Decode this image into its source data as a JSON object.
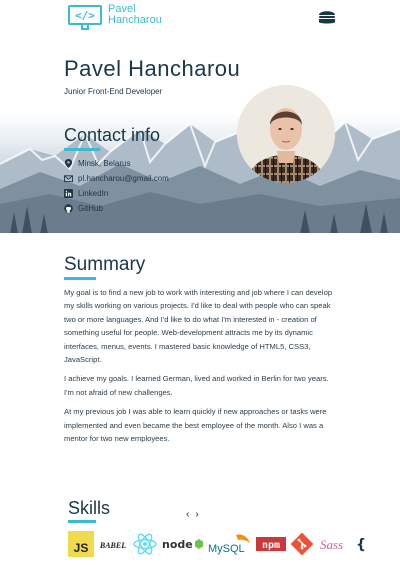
{
  "header": {
    "logo_text_line1": "Pavel",
    "logo_text_line2": "Hancharou",
    "logo_symbol": "</>",
    "menu_icon": "hamburger-icon"
  },
  "profile": {
    "name": "Pavel Hancharou",
    "role": "Junior Front-End Developer"
  },
  "contact": {
    "title": "Contact info",
    "items": [
      {
        "icon": "map-marker-icon",
        "text": "Minsk, Belarus"
      },
      {
        "icon": "envelope-icon",
        "text": "pl.hancharou@gmail.com"
      },
      {
        "icon": "linkedin-icon",
        "text": "LinkedIn"
      },
      {
        "icon": "github-icon",
        "text": "GitHub"
      }
    ]
  },
  "summary": {
    "title": "Summary",
    "paragraphs": [
      "My goal is to find a new job to work with interesting and job where I can develop my skills working on various projects. I'd like to deal with people who can speak two or more languages. And I'd like to do what I'm interested in - creation of something useful for people. Web-development attracts me by its dynamic interfaces, menus, events. I mastered basic knowledge of HTML5, CSS3, JavaScript.",
      "I achieve my goals. I learned German, lived and worked in Berlin for two years. I'm not afraid of new challenges.",
      "At my previous job I was able to learn quickly if new approaches or tasks were implemented and even became the best employee of the month. Also I was a mentor for two new employees."
    ]
  },
  "skills": {
    "title": "Skills",
    "prev": "‹",
    "next": "›",
    "logos": [
      {
        "name": "js-logo",
        "label": "JS"
      },
      {
        "name": "babel-logo",
        "label": "BABEL"
      },
      {
        "name": "react-logo",
        "label": ""
      },
      {
        "name": "nodejs-logo",
        "label": "node"
      },
      {
        "name": "mysql-logo",
        "label": "MySQL"
      },
      {
        "name": "npm-logo",
        "label": "npm"
      },
      {
        "name": "git-logo",
        "label": ""
      },
      {
        "name": "sass-logo",
        "label": "Sass"
      }
    ]
  },
  "colors": {
    "accent": "#3bbbd0",
    "heading": "#17394a",
    "js": "#f0db4f",
    "react": "#61dafb",
    "npm": "#cb3837",
    "git": "#f05033",
    "sass": "#cd6799",
    "mysql": "#00758f"
  }
}
